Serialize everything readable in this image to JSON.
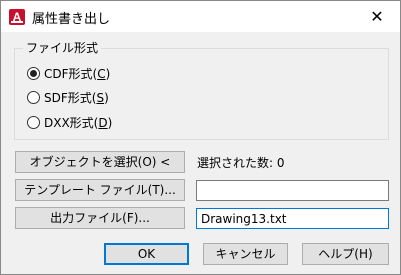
{
  "window": {
    "title": "属性書き出し",
    "close_glyph": "✕",
    "icon_letter": "A"
  },
  "group": {
    "label": "ファイル形式",
    "options": [
      {
        "prefix": "CDF形式(",
        "accel": "C",
        "suffix": ")",
        "checked": true
      },
      {
        "prefix": "SDF形式(",
        "accel": "S",
        "suffix": ")",
        "checked": false
      },
      {
        "prefix": "DXX形式(",
        "accel": "D",
        "suffix": ")",
        "checked": false
      }
    ]
  },
  "select_objects": {
    "label": "オブジェクトを選択(O) <",
    "status": "選択された数:  0"
  },
  "template": {
    "label": "テンプレート ファイル(T)...",
    "value": ""
  },
  "output": {
    "label": "出力ファイル(F)...",
    "value": "Drawing13.txt"
  },
  "buttons": {
    "ok": "OK",
    "cancel": "キャンセル",
    "help": "ヘルプ(H)"
  },
  "colors": {
    "accent": "#0078d7",
    "icon_red": "#c8102e"
  }
}
